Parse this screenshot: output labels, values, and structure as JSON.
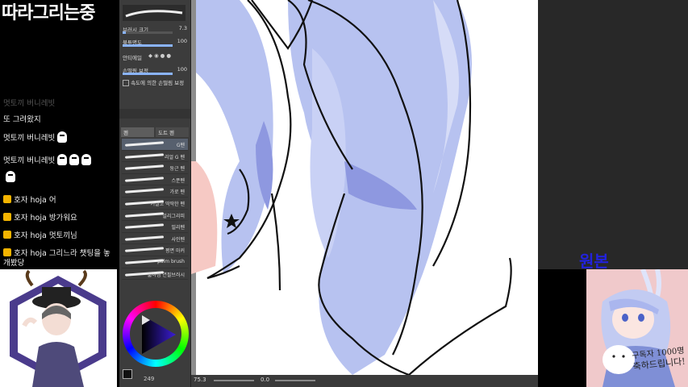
{
  "stream": {
    "title": "따라그리는중"
  },
  "chat": [
    {
      "text": "멋토끼 버니레빗 ",
      "faded": true,
      "badge": false,
      "ghosts": 0
    },
    {
      "text": "또 그려왔지",
      "faded": false,
      "badge": false,
      "ghosts": 0
    },
    {
      "text": "멋토끼 버니레빗",
      "faded": false,
      "badge": false,
      "ghosts": 1
    },
    {
      "text": "멋토끼 버니레빗",
      "faded": false,
      "badge": false,
      "ghosts": 3
    },
    {
      "text": "",
      "faded": false,
      "badge": false,
      "ghosts": 1
    },
    {
      "text": "호자 hoja 어",
      "faded": false,
      "badge": true,
      "ghosts": 0
    },
    {
      "text": "호자 hoja 방가워요",
      "faded": false,
      "badge": true,
      "ghosts": 0
    },
    {
      "text": "호자 hoja 멋토끼님",
      "faded": false,
      "badge": true,
      "ghosts": 0
    },
    {
      "text": "호자 hoja 그리느라 챗팅을 놓",
      "faded": false,
      "badge": true,
      "ghosts": 0
    },
    {
      "text": "개봤당",
      "faded": false,
      "badge": false,
      "ghosts": 0
    }
  ],
  "tool_panel": {
    "brush_size_label": "브러시 크기",
    "brush_size_value": "7.3",
    "opacity_label": "불투명도",
    "opacity_value": "100",
    "antialias_label": "안티에일",
    "correction_label": "손떨림 보정",
    "correction_value": "100",
    "speed_label": "속도에 의한 손떨림 보정",
    "brush_size_fill": 0.07,
    "opacity_fill": 1.0,
    "correction_fill": 1.0,
    "tabs": [
      "펜",
      "도트 펜"
    ],
    "brushes": [
      {
        "name": "G펜",
        "selected": true
      },
      {
        "name": "리얼 G 펜",
        "selected": false
      },
      {
        "name": "둥근 펜",
        "selected": false
      },
      {
        "name": "스푼펜",
        "selected": false
      },
      {
        "name": "가로 펜",
        "selected": false
      },
      {
        "name": "거칠고 딱딱한 펜",
        "selected": false
      },
      {
        "name": "밀리그리피",
        "selected": false
      },
      {
        "name": "밀리펜",
        "selected": false
      },
      {
        "name": "사인펜",
        "selected": false
      },
      {
        "name": "평면 마커",
        "selected": false
      },
      {
        "name": "palm brush",
        "selected": false
      },
      {
        "name": "얇아짐 연필브러시",
        "selected": false
      }
    ],
    "bottom_status": "249"
  },
  "canvas": {
    "zoom": "75.3",
    "angle": "0.0"
  },
  "reference": {
    "label": "원본",
    "caption_line1": "구독자 1000명",
    "caption_line2": "축하드립니다!"
  },
  "colors": {
    "hair": "#b7c2f0",
    "hair_shadow": "#8e98e0",
    "skin": "#f6c9c4",
    "accent": "#8ab4ff"
  }
}
